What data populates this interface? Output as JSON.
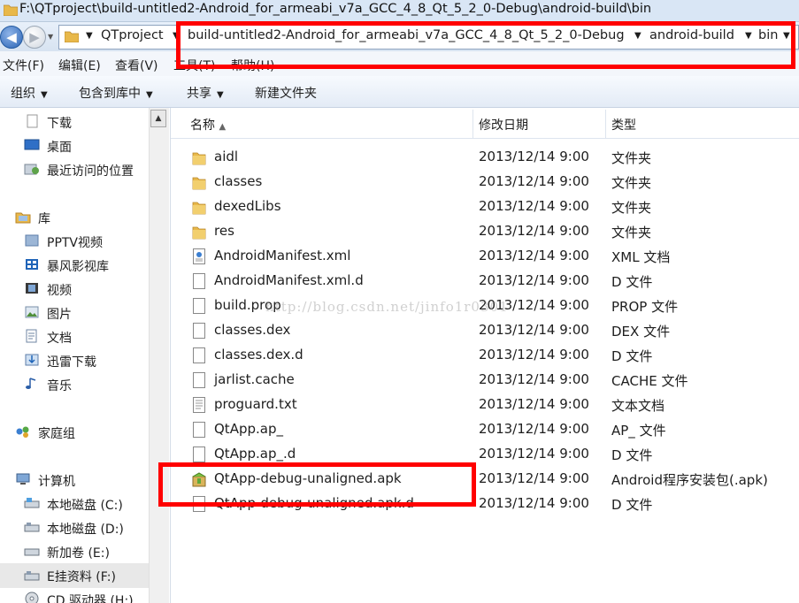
{
  "window": {
    "title": "F:\\QTproject\\build-untitled2-Android_for_armeabi_v7a_GCC_4_8_Qt_5_2_0-Debug\\android-build\\bin"
  },
  "address": {
    "crumbs": [
      {
        "label": "QTproject"
      },
      {
        "label": "build-untitled2-Android_for_armeabi_v7a_GCC_4_8_Qt_5_2_0-Debug"
      },
      {
        "label": "android-build"
      },
      {
        "label": "bin"
      }
    ]
  },
  "menu": {
    "file": "文件(F)",
    "edit": "编辑(E)",
    "view": "查看(V)",
    "tools": "工具(T)",
    "help": "帮助(H)"
  },
  "toolbar": {
    "organize": "组织",
    "include_in_library": "包含到库中",
    "share": "共享",
    "new_folder": "新建文件夹"
  },
  "nav": {
    "items": [
      {
        "label": "下载",
        "icon": "download-folder-icon"
      },
      {
        "label": "桌面",
        "icon": "desktop-icon"
      },
      {
        "label": "最近访问的位置",
        "icon": "recent-places-icon"
      },
      {
        "label": "库",
        "icon": "library-icon"
      },
      {
        "label": "PPTV视频",
        "icon": "pptv-icon"
      },
      {
        "label": "暴风影视库",
        "icon": "storm-video-icon"
      },
      {
        "label": "视频",
        "icon": "video-library-icon"
      },
      {
        "label": "图片",
        "icon": "pictures-icon"
      },
      {
        "label": "文档",
        "icon": "documents-icon"
      },
      {
        "label": "迅雷下载",
        "icon": "thunder-download-icon"
      },
      {
        "label": "音乐",
        "icon": "music-icon"
      },
      {
        "label": "家庭组",
        "icon": "homegroup-icon"
      },
      {
        "label": "计算机",
        "icon": "computer-icon"
      },
      {
        "label": "本地磁盘 (C:)",
        "icon": "drive-c-icon"
      },
      {
        "label": "本地磁盘 (D:)",
        "icon": "drive-d-icon"
      },
      {
        "label": "新加卷 (E:)",
        "icon": "drive-e-icon"
      },
      {
        "label": "E挂资料 (F:)",
        "icon": "drive-f-icon"
      },
      {
        "label": "CD 驱动器 (H:)",
        "icon": "cd-drive-icon"
      }
    ]
  },
  "columns": {
    "name": "名称",
    "modified": "修改日期",
    "type": "类型"
  },
  "files": [
    {
      "name": "aidl",
      "date": "2013/12/14 9:00",
      "type": "文件夹",
      "icon": "folder-icon"
    },
    {
      "name": "classes",
      "date": "2013/12/14 9:00",
      "type": "文件夹",
      "icon": "folder-icon"
    },
    {
      "name": "dexedLibs",
      "date": "2013/12/14 9:00",
      "type": "文件夹",
      "icon": "folder-icon"
    },
    {
      "name": "res",
      "date": "2013/12/14 9:00",
      "type": "文件夹",
      "icon": "folder-icon"
    },
    {
      "name": "AndroidManifest.xml",
      "date": "2013/12/14 9:00",
      "type": "XML 文档",
      "icon": "xml-file-icon"
    },
    {
      "name": "AndroidManifest.xml.d",
      "date": "2013/12/14 9:00",
      "type": "D 文件",
      "icon": "file-icon"
    },
    {
      "name": "build.prop",
      "date": "2013/12/14 9:00",
      "type": "PROP 文件",
      "icon": "file-icon"
    },
    {
      "name": "classes.dex",
      "date": "2013/12/14 9:00",
      "type": "DEX 文件",
      "icon": "file-icon"
    },
    {
      "name": "classes.dex.d",
      "date": "2013/12/14 9:00",
      "type": "D 文件",
      "icon": "file-icon"
    },
    {
      "name": "jarlist.cache",
      "date": "2013/12/14 9:00",
      "type": "CACHE 文件",
      "icon": "file-icon"
    },
    {
      "name": "proguard.txt",
      "date": "2013/12/14 9:00",
      "type": "文本文档",
      "icon": "text-file-icon"
    },
    {
      "name": "QtApp.ap_",
      "date": "2013/12/14 9:00",
      "type": "AP_ 文件",
      "icon": "file-icon"
    },
    {
      "name": "QtApp.ap_.d",
      "date": "2013/12/14 9:00",
      "type": "D 文件",
      "icon": "file-icon"
    },
    {
      "name": "QtApp-debug-unaligned.apk",
      "date": "2013/12/14 9:00",
      "type": "Android程序安装包(.apk)",
      "icon": "apk-package-icon"
    },
    {
      "name": "QtApp-debug-unaligned.apk.d",
      "date": "2013/12/14 9:00",
      "type": "D 文件",
      "icon": "file-icon"
    }
  ],
  "watermark": "http://blog.csdn.net/jinfo1r0301",
  "colors": {
    "annotation_red": "#ff0000",
    "folder_yellow": "#e8b84a",
    "address_bg": "#ffffff"
  }
}
